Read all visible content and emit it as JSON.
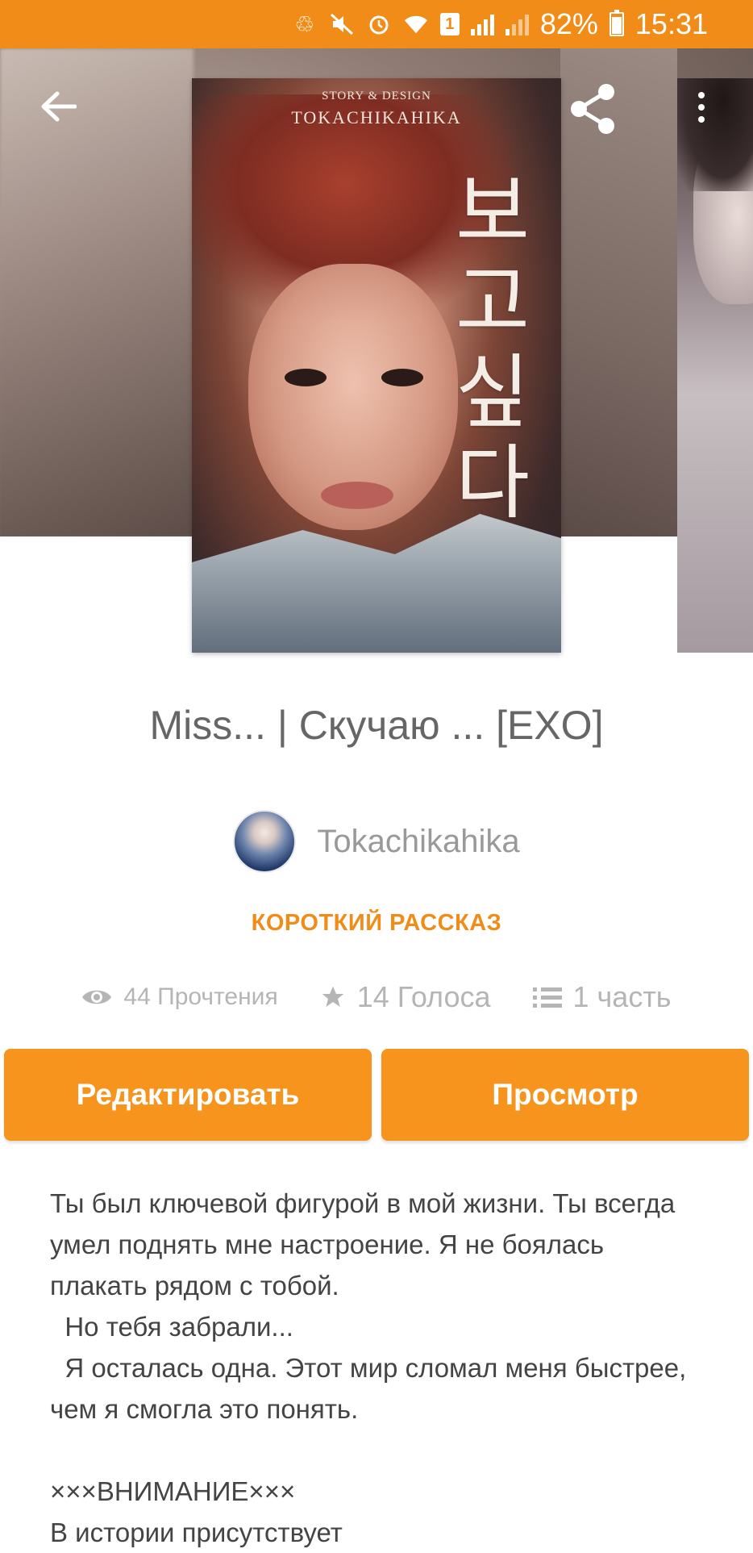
{
  "status_bar": {
    "battery_percent": "82%",
    "time": "15:31",
    "sim_slot": "1",
    "icons": [
      "recycle-icon",
      "mute-icon",
      "alarm-icon",
      "wifi-icon",
      "sim-icon",
      "signal-icon",
      "signal-weak-icon",
      "battery-icon"
    ]
  },
  "cover": {
    "credit_small": "STORY & DESIGN",
    "credit_name": "TOKACHIKAHIKA",
    "korean_lines": [
      "보",
      "고",
      "싶",
      "다"
    ]
  },
  "story": {
    "title": "Miss... | Скучаю ... [EXO]",
    "author": "Tokachikahika",
    "category": "КОРОТКИЙ РАССКАЗ",
    "reads": "44 Прочтения",
    "votes": "14 Голоса",
    "parts": "1 часть",
    "description": "Ты был ключевой фигурой в мой жизни. Ты всегда умел поднять мне настроение. Я не боялась плакать рядом с тобой.\n  Но тебя забрали...\n  Я осталась одна. Этот мир сломал меня быстрее, чем я смогла это понять.\n\n×××ВНИМАНИЕ×××\nВ истории присутствует"
  },
  "actions": {
    "edit_label": "Редактировать",
    "view_label": "Просмотр"
  },
  "colors": {
    "accent": "#f7941d",
    "status_bar": "#f28c18",
    "muted_text": "#999999"
  }
}
